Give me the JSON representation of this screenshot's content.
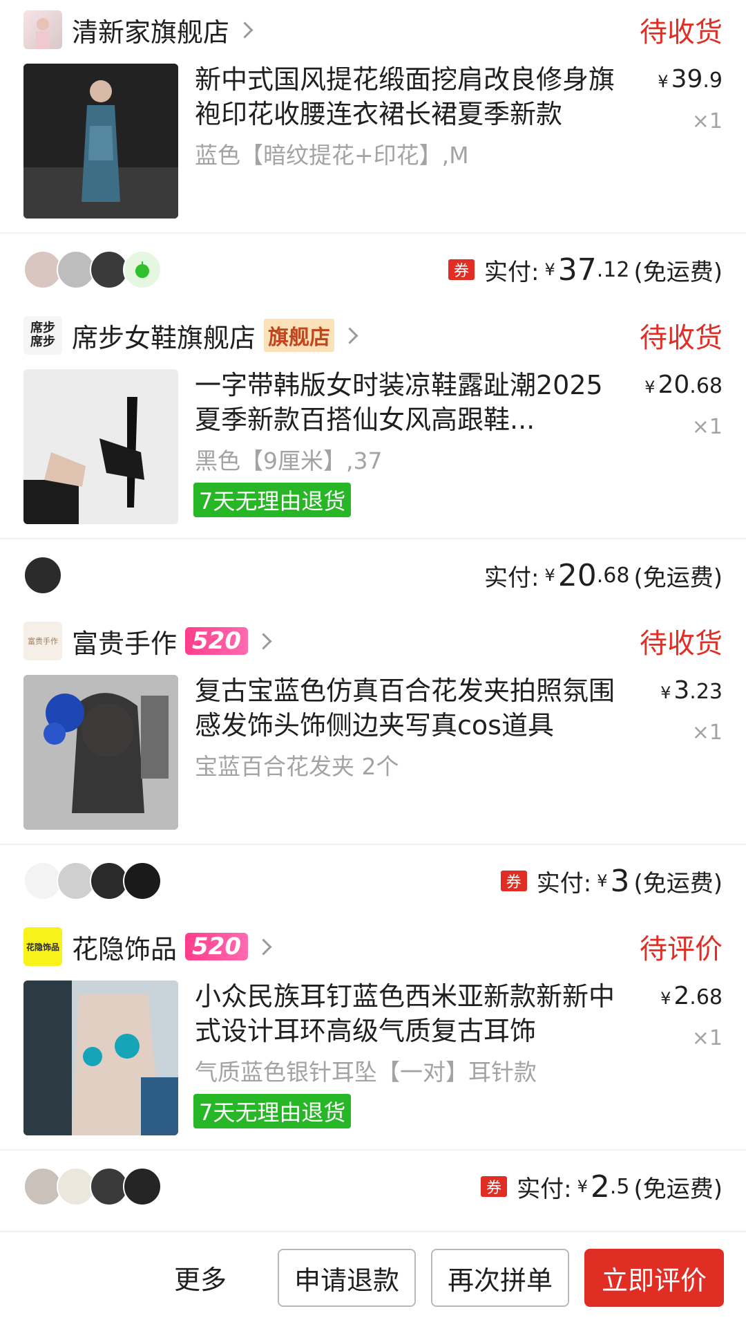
{
  "orders": [
    {
      "shop": "清新家旗舰店",
      "status": "待收货",
      "title": "新中式国风提花缎面挖肩改良修身旗袍印花收腰连衣裙长裙夏季新款",
      "spec": "蓝色【暗纹提花+印花】,M",
      "price_int": "39",
      "price_dec": ".9",
      "qty": "×1",
      "yen": "¥"
    },
    {
      "pay_label": "实付:",
      "pay_int": "37",
      "pay_dec": ".12",
      "pay_ship": "(免运费)",
      "coupon": "券",
      "shop": "席步女鞋旗舰店",
      "shop_logo_text": "席步\n席步",
      "tag": "旗舰店",
      "status": "待收货",
      "title": "一字带韩版女时装凉鞋露趾潮2025夏季新款百搭仙女风高跟鞋...",
      "spec": "黑色【9厘米】,37",
      "return_badge": "7天无理由退货",
      "price_int": "20",
      "price_dec": ".68",
      "qty": "×1"
    },
    {
      "pay_label": "实付:",
      "pay_int": "20",
      "pay_dec": ".68",
      "pay_ship": "(免运费)",
      "shop": "富贵手作",
      "shop_logo_text": "富贵手作",
      "tag": "520",
      "status": "待收货",
      "title": "复古宝蓝色仿真百合花发夹拍照氛围感发饰头饰侧边夹写真cos道具",
      "spec": "宝蓝百合花发夹 2个",
      "price_int": "3",
      "price_dec": ".23",
      "qty": "×1"
    },
    {
      "pay_label": "实付:",
      "pay_int": "3",
      "pay_dec": "",
      "pay_ship": "(免运费)",
      "coupon": "券",
      "shop": "花隐饰品",
      "shop_logo_text": "花隐饰品",
      "tag": "520",
      "status": "待评价",
      "title": "小众民族耳钉蓝色西米亚新款新新中式设计耳环高级气质复古耳饰",
      "spec": "气质蓝色银针耳坠【一对】耳针款",
      "return_badge": "7天无理由退货",
      "price_int": "2",
      "price_dec": ".68",
      "qty": "×1"
    },
    {
      "pay_label": "实付:",
      "pay_int": "2",
      "pay_dec": ".5",
      "pay_ship": "(免运费)",
      "coupon": "券"
    }
  ],
  "bottom": {
    "more": "更多",
    "refund": "申请退款",
    "regroup": "再次拼单",
    "review": "立即评价"
  },
  "colors": {
    "accent_red": "#e02e24",
    "green_badge": "#26b626",
    "tag_pink": "#ff3d8a"
  },
  "icons": [
    "chevron-right-icon",
    "coupon-icon",
    "avatar"
  ]
}
